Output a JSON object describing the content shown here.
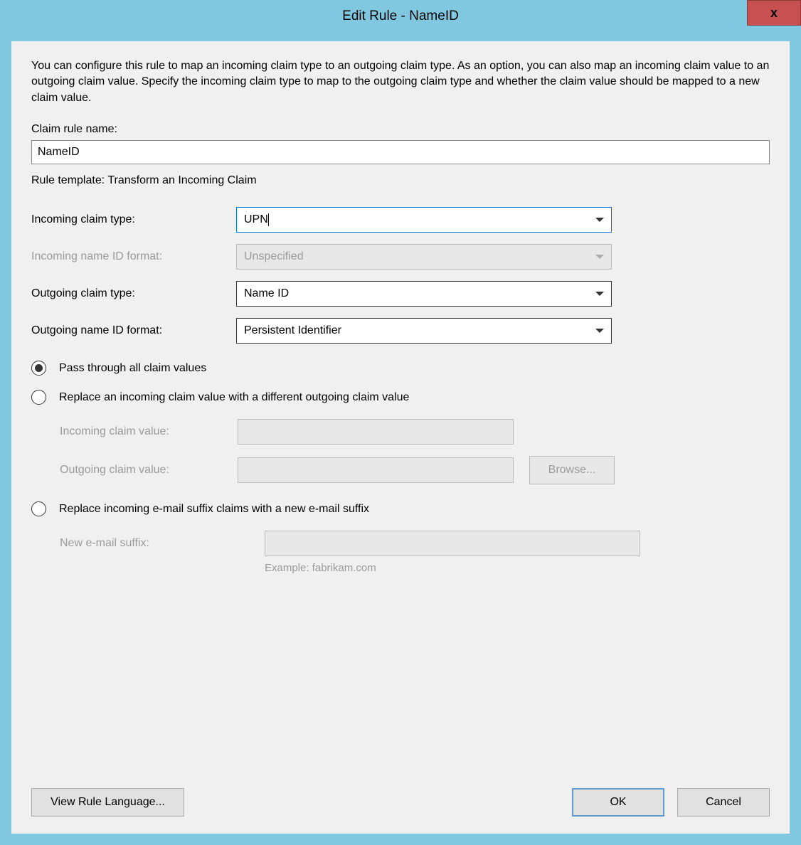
{
  "window": {
    "title": "Edit Rule - NameID",
    "close_label": "x"
  },
  "description": "You can configure this rule to map an incoming claim type to an outgoing claim type. As an option, you can also map an incoming claim value to an outgoing claim value. Specify the incoming claim type to map to the outgoing claim type and whether the claim value should be mapped to a new claim value.",
  "claim_rule_name": {
    "label": "Claim rule name:",
    "value": "NameID"
  },
  "rule_template": "Rule template: Transform an Incoming Claim",
  "fields": {
    "incoming_claim_type": {
      "label": "Incoming claim type:",
      "value": "UPN"
    },
    "incoming_name_id_format": {
      "label": "Incoming name ID format:",
      "value": "Unspecified"
    },
    "outgoing_claim_type": {
      "label": "Outgoing claim type:",
      "value": "Name ID"
    },
    "outgoing_name_id_format": {
      "label": "Outgoing name ID format:",
      "value": "Persistent Identifier"
    }
  },
  "radios": {
    "pass_through": "Pass through all claim values",
    "replace_value": "Replace an incoming claim value with a different outgoing claim value",
    "replace_suffix": "Replace incoming e-mail suffix claims with a new e-mail suffix"
  },
  "sub_fields": {
    "incoming_claim_value": "Incoming claim value:",
    "outgoing_claim_value": "Outgoing claim value:",
    "browse": "Browse...",
    "new_email_suffix": "New e-mail suffix:",
    "example": "Example: fabrikam.com"
  },
  "buttons": {
    "view_rule": "View Rule Language...",
    "ok": "OK",
    "cancel": "Cancel"
  }
}
